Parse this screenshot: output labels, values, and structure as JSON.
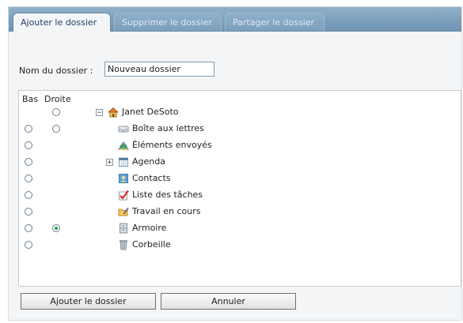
{
  "tabs": [
    {
      "label": "Ajouter le dossier",
      "active": true
    },
    {
      "label": "Supprimer le dossier",
      "active": false
    },
    {
      "label": "Partager le dossier",
      "active": false
    }
  ],
  "form": {
    "name_label": "Nom du dossier :",
    "name_value": "Nouveau dossier"
  },
  "columns": {
    "bas": "Bas",
    "droite": "Droite"
  },
  "tree": [
    {
      "label": "Janet DeSoto",
      "icon": "home-icon",
      "expander": "minus",
      "bas": null,
      "droite": false
    },
    {
      "label": "Boîte aux lettres",
      "icon": "inbox-icon",
      "bas": false,
      "droite": false
    },
    {
      "label": "Éléments envoyés",
      "icon": "sent-items-icon",
      "bas": false,
      "droite": null
    },
    {
      "label": "Agenda",
      "icon": "calendar-icon",
      "expander": "plus",
      "bas": false,
      "droite": null
    },
    {
      "label": "Contacts",
      "icon": "contacts-icon",
      "bas": false,
      "droite": null
    },
    {
      "label": "Liste des tâches",
      "icon": "task-list-icon",
      "bas": false,
      "droite": null
    },
    {
      "label": "Travail en cours",
      "icon": "work-in-progress-icon",
      "bas": false,
      "droite": null
    },
    {
      "label": "Armoire",
      "icon": "cabinet-icon",
      "bas": false,
      "droite": true
    },
    {
      "label": "Corbeille",
      "icon": "trash-icon",
      "bas": false,
      "droite": null
    }
  ],
  "buttons": {
    "add": "Ajouter le dossier",
    "cancel": "Annuler"
  },
  "colors": {
    "tab_bar": "#7b9fbd",
    "active_tab_text": "#223f66",
    "radio_checked": "#2c9a4a"
  }
}
